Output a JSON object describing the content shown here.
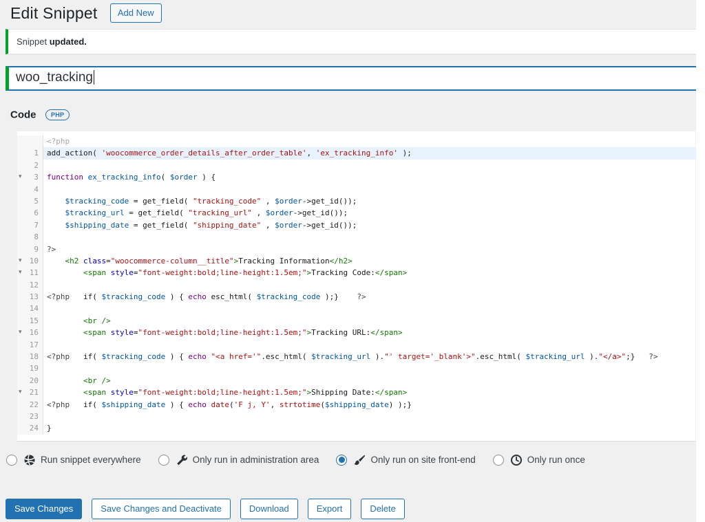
{
  "page": {
    "title": "Edit Snippet",
    "add_new_label": "Add New"
  },
  "notice": {
    "prefix": "Snippet ",
    "bold": "updated."
  },
  "title_field": {
    "value": "woo_tracking"
  },
  "code_section": {
    "label": "Code",
    "badge": "PHP"
  },
  "colors": {
    "accent_blue": "#2271b1",
    "success_green": "#00a32a",
    "active_line_bg": "#e8f2fc",
    "page_bg": "#f0f0f1"
  },
  "editor": {
    "active_line": 1,
    "fold_lines": [
      3,
      10,
      11,
      16,
      21
    ],
    "prelude_tokens": [
      [
        "m2",
        "<?php"
      ]
    ],
    "lines": [
      {
        "n": 1,
        "tokens": [
          [
            "p",
            "add_action( "
          ],
          [
            "s",
            "'woocommerce_order_details_after_order_table'"
          ],
          [
            "p",
            ", "
          ],
          [
            "s",
            "'ex_tracking_info'"
          ],
          [
            "p",
            " );"
          ]
        ]
      },
      {
        "n": 2,
        "tokens": []
      },
      {
        "n": 3,
        "tokens": [
          [
            "k",
            "function"
          ],
          [
            "p",
            " "
          ],
          [
            "v",
            "ex_tracking_info"
          ],
          [
            "p",
            "( "
          ],
          [
            "v",
            "$order"
          ],
          [
            "p",
            " ) {"
          ]
        ]
      },
      {
        "n": 4,
        "tokens": []
      },
      {
        "n": 5,
        "tokens": [
          [
            "p",
            "    "
          ],
          [
            "v",
            "$tracking_code"
          ],
          [
            "p",
            " = get_field( "
          ],
          [
            "s",
            "\"tracking_code\""
          ],
          [
            "p",
            " , "
          ],
          [
            "v",
            "$order"
          ],
          [
            "p",
            "->get_id());"
          ]
        ]
      },
      {
        "n": 6,
        "tokens": [
          [
            "p",
            "    "
          ],
          [
            "v",
            "$tracking_url"
          ],
          [
            "p",
            " = get_field( "
          ],
          [
            "s",
            "\"tracking_url\""
          ],
          [
            "p",
            " , "
          ],
          [
            "v",
            "$order"
          ],
          [
            "p",
            "->get_id());"
          ]
        ]
      },
      {
        "n": 7,
        "tokens": [
          [
            "p",
            "    "
          ],
          [
            "v",
            "$shipping_date"
          ],
          [
            "p",
            " = get_field( "
          ],
          [
            "s",
            "\"shipping_date\""
          ],
          [
            "p",
            " , "
          ],
          [
            "v",
            "$order"
          ],
          [
            "p",
            "->get_id());"
          ]
        ]
      },
      {
        "n": 8,
        "tokens": []
      },
      {
        "n": 9,
        "tokens": [
          [
            "m",
            "?>"
          ]
        ]
      },
      {
        "n": 10,
        "tokens": [
          [
            "p",
            "    "
          ],
          [
            "t",
            "<h2"
          ],
          [
            "p",
            " "
          ],
          [
            "a",
            "class"
          ],
          [
            "p",
            "="
          ],
          [
            "s",
            "\"woocommerce-column__title\""
          ],
          [
            "t",
            ">"
          ],
          [
            "p",
            "Tracking Information"
          ],
          [
            "t",
            "</h2>"
          ]
        ]
      },
      {
        "n": 11,
        "tokens": [
          [
            "p",
            "        "
          ],
          [
            "t",
            "<span"
          ],
          [
            "p",
            " "
          ],
          [
            "a",
            "style"
          ],
          [
            "p",
            "="
          ],
          [
            "s",
            "\"font-weight:bold;line-height:1.5em;\""
          ],
          [
            "t",
            ">"
          ],
          [
            "p",
            "Tracking Code:"
          ],
          [
            "t",
            "</span>"
          ]
        ]
      },
      {
        "n": 12,
        "tokens": []
      },
      {
        "n": 13,
        "tokens": [
          [
            "m",
            "<?php"
          ],
          [
            "p",
            "   if( "
          ],
          [
            "v",
            "$tracking_code"
          ],
          [
            "p",
            " ) { "
          ],
          [
            "k",
            "echo"
          ],
          [
            "p",
            " esc_html( "
          ],
          [
            "v",
            "$tracking_code"
          ],
          [
            "p",
            " );}    "
          ],
          [
            "m",
            "?>"
          ]
        ]
      },
      {
        "n": 14,
        "tokens": []
      },
      {
        "n": 15,
        "tokens": [
          [
            "p",
            "        "
          ],
          [
            "t",
            "<br />"
          ]
        ]
      },
      {
        "n": 16,
        "tokens": [
          [
            "p",
            "        "
          ],
          [
            "t",
            "<span"
          ],
          [
            "p",
            " "
          ],
          [
            "a",
            "style"
          ],
          [
            "p",
            "="
          ],
          [
            "s",
            "\"font-weight:bold;line-height:1.5em;\""
          ],
          [
            "t",
            ">"
          ],
          [
            "p",
            "Tracking URL:"
          ],
          [
            "t",
            "</span>"
          ]
        ]
      },
      {
        "n": 17,
        "tokens": []
      },
      {
        "n": 18,
        "tokens": [
          [
            "m",
            "<?php"
          ],
          [
            "p",
            "   if( "
          ],
          [
            "v",
            "$tracking_code"
          ],
          [
            "p",
            " ) { "
          ],
          [
            "k",
            "echo"
          ],
          [
            "p",
            " "
          ],
          [
            "s",
            "\"<a href='\""
          ],
          [
            "p",
            ".esc_html( "
          ],
          [
            "v",
            "$tracking_url"
          ],
          [
            "p",
            " )."
          ],
          [
            "s",
            "\"' target='_blank'>\""
          ],
          [
            "p",
            ".esc_html( "
          ],
          [
            "v",
            "$tracking_url"
          ],
          [
            "p",
            " )."
          ],
          [
            "s",
            "\"</a>\""
          ],
          [
            "p",
            ";}   "
          ],
          [
            "m",
            "?>"
          ]
        ]
      },
      {
        "n": 19,
        "tokens": []
      },
      {
        "n": 20,
        "tokens": [
          [
            "p",
            "        "
          ],
          [
            "t",
            "<br />"
          ]
        ]
      },
      {
        "n": 21,
        "tokens": [
          [
            "p",
            "        "
          ],
          [
            "t",
            "<span"
          ],
          [
            "p",
            " "
          ],
          [
            "a",
            "style"
          ],
          [
            "p",
            "="
          ],
          [
            "s",
            "\"font-weight:bold;line-height:1.5em;\""
          ],
          [
            "t",
            ">"
          ],
          [
            "p",
            "Shipping Date:"
          ],
          [
            "t",
            "</span>"
          ]
        ]
      },
      {
        "n": 22,
        "tokens": [
          [
            "m",
            "<?php"
          ],
          [
            "p",
            "   if( "
          ],
          [
            "v",
            "$shipping_date"
          ],
          [
            "p",
            " ) { "
          ],
          [
            "k",
            "echo"
          ],
          [
            "p",
            " "
          ],
          [
            "b",
            "date"
          ],
          [
            "p",
            "("
          ],
          [
            "s",
            "'F j, Y'"
          ],
          [
            "p",
            ", "
          ],
          [
            "b",
            "strtotime"
          ],
          [
            "p",
            "("
          ],
          [
            "v",
            "$shipping_date"
          ],
          [
            "p",
            ") );}"
          ]
        ]
      },
      {
        "n": 23,
        "tokens": []
      },
      {
        "n": 24,
        "tokens": [
          [
            "p",
            "}"
          ]
        ]
      }
    ]
  },
  "scope": {
    "options": [
      {
        "label": "Run snippet everywhere",
        "icon": "globe-icon",
        "selected": false
      },
      {
        "label": "Only run in administration area",
        "icon": "wrench-icon",
        "selected": false
      },
      {
        "label": "Only run on site front-end",
        "icon": "brush-icon",
        "selected": true
      },
      {
        "label": "Only run once",
        "icon": "clock-icon",
        "selected": false
      }
    ]
  },
  "actions": {
    "primary": "Save Changes",
    "secondary": [
      "Save Changes and Deactivate",
      "Download",
      "Export",
      "Delete"
    ]
  }
}
